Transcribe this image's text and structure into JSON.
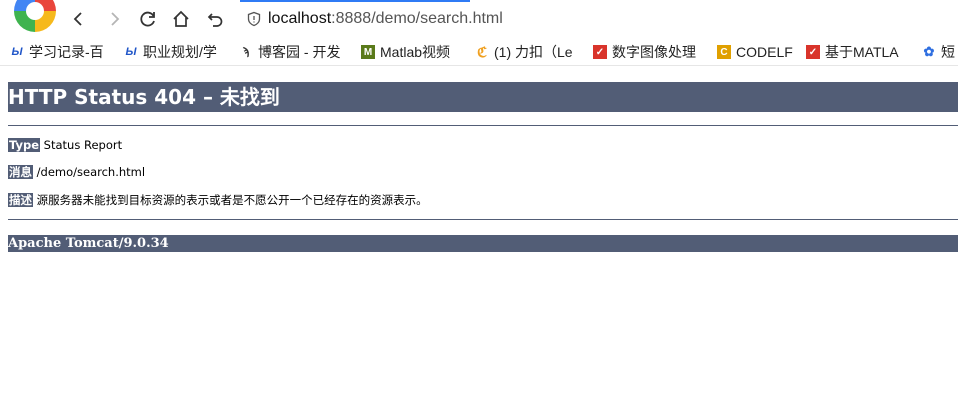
{
  "browser": {
    "address_host": "localhost",
    "address_rest": ":8888/demo/search.html"
  },
  "bookmarks": [
    {
      "label": "学习记录-百",
      "icon": "baidu-edu-icon",
      "color": "#1f55c8"
    },
    {
      "label": "职业规划/学",
      "icon": "baidu-edu-icon",
      "color": "#1f55c8"
    },
    {
      "label": "博客园 - 开发",
      "icon": "cnblogs-icon",
      "color": "#333333"
    },
    {
      "label": "Matlab视频",
      "icon": "matlab-icon",
      "color": "#5a7a1a"
    },
    {
      "label": "(1) 力扣（Le",
      "icon": "leetcode-icon",
      "color": "#f0a020"
    },
    {
      "label": "数字图像处理",
      "icon": "bookmark-red-icon",
      "color": "#d9342b"
    },
    {
      "label": "CODELF",
      "icon": "codelf-icon",
      "color": "#e0a000"
    },
    {
      "label": "基于MATLA",
      "icon": "bookmark-red-icon",
      "color": "#d9342b"
    },
    {
      "label": "短",
      "icon": "baidu-paw-icon",
      "color": "#2f6fe0"
    }
  ],
  "page": {
    "heading": "HTTP Status 404 – 未找到",
    "type_label": "Type",
    "type_value": "Status Report",
    "message_label": "消息",
    "message_value": "/demo/search.html",
    "description_label": "描述",
    "description_value": "源服务器未能找到目标资源的表示或者是不愿公开一个已经存在的资源表示。",
    "footer": "Apache Tomcat/9.0.34"
  }
}
